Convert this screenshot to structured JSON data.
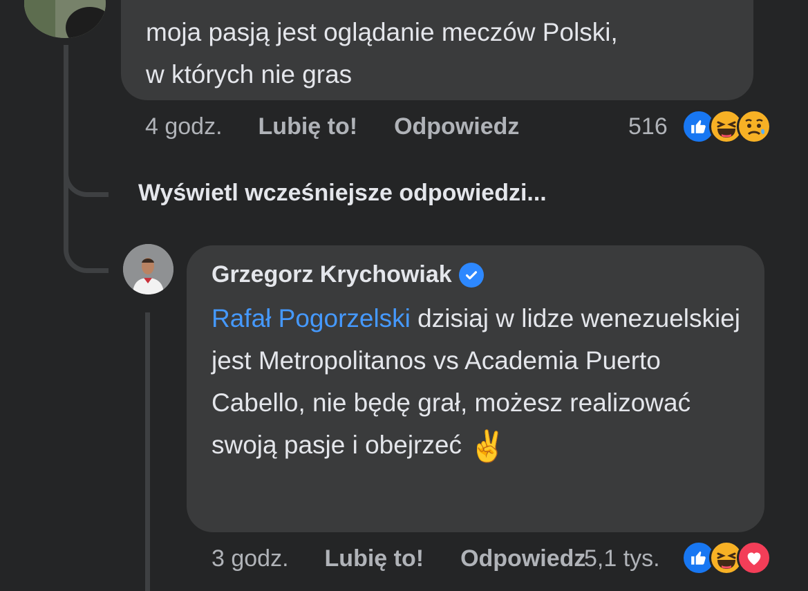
{
  "comment1": {
    "text": "moja pasją jest oglądanie meczów Polski,\nw których nie gras",
    "time": "4 godz.",
    "like_label": "Lubię to!",
    "reply_label": "Odpowiedz",
    "reaction_count": "516",
    "reactions": [
      "like-icon",
      "haha-icon",
      "sad-icon"
    ]
  },
  "view_earlier_label": "Wyświetl wcześniejsze odpowiedzi...",
  "comment2": {
    "author": "Grzegorz Krychowiak",
    "mention": "Rafał Pogorzelski",
    "text_line1": " dzisiaj w lidze",
    "text_rest": "wenezuelskiej jest Metropolitanos vs Academia Puerto Cabello, nie będę grał, możesz realizować swoją pasje i obejrzeć",
    "emoji": "✌️",
    "time": "3 godz.",
    "like_label": "Lubię to!",
    "reply_label": "Odpowiedz",
    "reaction_count": "5,1 tys.",
    "reactions": [
      "like-icon",
      "haha-icon",
      "love-icon"
    ]
  },
  "colors": {
    "background": "#242526",
    "bubble": "#3a3b3c",
    "mention": "#4599ff",
    "like": "#1877f2",
    "love": "#f33e58",
    "haha": "#f7b125"
  }
}
